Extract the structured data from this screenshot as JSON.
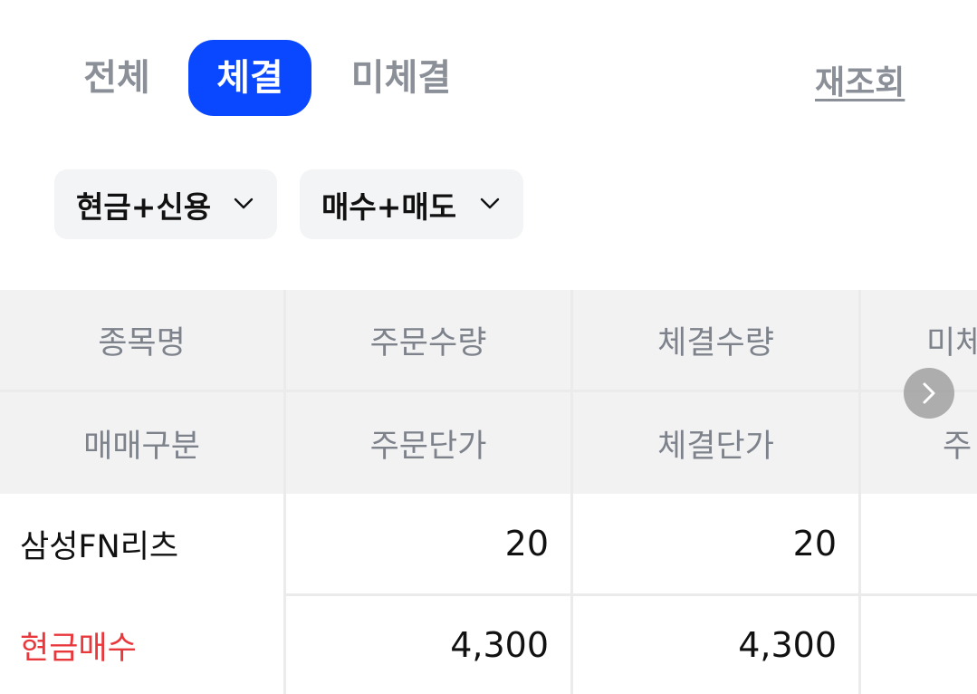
{
  "tabs": {
    "all": "전체",
    "filled": "체결",
    "unfilled": "미체결"
  },
  "refresh_label": "재조회",
  "filters": {
    "account_type": "현금+신용",
    "trade_type": "매수+매도"
  },
  "table": {
    "headers_row1": [
      "종목명",
      "주문수량",
      "체결수량",
      "미체"
    ],
    "headers_row2": [
      "매매구분",
      "주문단가",
      "체결단가",
      "주"
    ],
    "rows": [
      {
        "name": "삼성FN리츠",
        "order_qty": "20",
        "filled_qty": "20",
        "trade_type": "현금매수",
        "order_price": "4,300",
        "filled_price": "4,300"
      }
    ]
  },
  "colors": {
    "accent": "#0a48ff",
    "buy": "#e8383c",
    "muted_text": "#8a8f98",
    "header_bg": "#f2f2f3"
  },
  "icons": {
    "dropdown": "chevron-down-icon",
    "scroll": "chevron-right-icon"
  }
}
